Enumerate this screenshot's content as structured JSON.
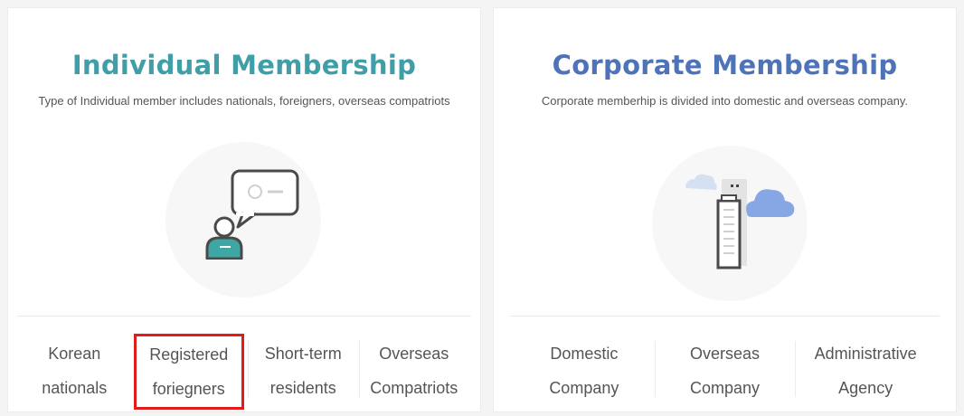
{
  "individual": {
    "title": "Individual Membership",
    "description": "Type of Individual member includes nationals, foreigners, overseas compatriots",
    "options": [
      {
        "label": "Korean\nnationals"
      },
      {
        "label": "Registered\nforiegners"
      },
      {
        "label": "Short-term\nresidents"
      },
      {
        "label": "Overseas\nCompatriots"
      }
    ],
    "selected_index": 1
  },
  "corporate": {
    "title": "Corporate Membership",
    "description": "Corporate memberhip is divided into domestic and overseas company.",
    "options": [
      {
        "label": "Domestic\nCompany"
      },
      {
        "label": "Overseas\nCompany"
      },
      {
        "label": "Administrative\nAgency"
      }
    ]
  },
  "colors": {
    "individual_title": "#3f9ea7",
    "corporate_title": "#4f73b8",
    "selection_outline": "#e21b1b"
  },
  "icons": {
    "individual": "person-speech-bubble-icon",
    "corporate": "building-cloud-icon"
  }
}
